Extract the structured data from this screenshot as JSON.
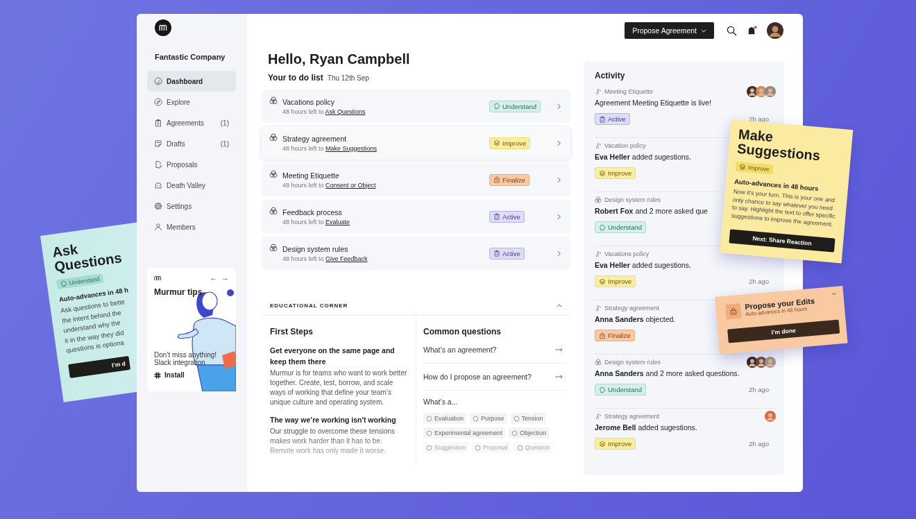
{
  "sidebar": {
    "company": "Fantastic Company",
    "items": [
      {
        "label": "Dashboard",
        "selected": true
      },
      {
        "label": "Explore",
        "selected": false
      },
      {
        "label": "Agreements",
        "count": "(1)",
        "selected": false
      },
      {
        "label": "Drafts",
        "count": "(1)",
        "selected": false
      },
      {
        "label": "Proposals",
        "selected": false
      },
      {
        "label": "Death Valley",
        "selected": false
      },
      {
        "label": "Settings",
        "selected": false
      },
      {
        "label": "Members",
        "selected": false
      }
    ]
  },
  "tips": {
    "title": "Murmur tips",
    "nav": [
      "←",
      "→"
    ],
    "message": "Don’t miss anything!",
    "detail": "Slack integration",
    "action": "Install"
  },
  "header": {
    "action": "Propose Agreement",
    "unread": true
  },
  "greeting": "Hello, Ryan Campbell",
  "todo": {
    "title": "Your to do list",
    "date": "Thu 12th Sep",
    "items": [
      {
        "title": "Vacations policy",
        "due": "48 hours left to",
        "task": "Ask Questions",
        "badge": {
          "kind": "understand",
          "label": "Understand"
        },
        "selected": false
      },
      {
        "title": "Strategy agreement",
        "due": "48 hours left to",
        "task": "Make Suggestions",
        "badge": {
          "kind": "improve",
          "label": "Improve"
        },
        "selected": true
      },
      {
        "title": "Meeting Etiquette",
        "due": "48 hours left to",
        "task": "Consent or Object",
        "badge": {
          "kind": "finalize",
          "label": "Finalize"
        },
        "selected": false
      },
      {
        "title": "Feedback process",
        "due": "48 hours left to",
        "task": "Evaluate",
        "badge": {
          "kind": "active",
          "label": "Active"
        },
        "selected": false
      },
      {
        "title": "Design system rules",
        "due": "48 hours left to",
        "task": "Give Feedback",
        "badge": {
          "kind": "active",
          "label": "Active"
        },
        "selected": false
      }
    ]
  },
  "education": {
    "title": "EDUCATIONAL CORNER",
    "expanded": true,
    "first_steps": {
      "title": "First Steps",
      "sections": [
        {
          "heading": "Get everyone on the same page and keep them there",
          "text": "Murmur is for teams who want to work better together. Create, test, borrow, and scale ways of working that define your team’s unique culture and operating system."
        },
        {
          "heading": "The way we’re working isn't working",
          "text": "Our struggle to overcome these tensions makes work harder than it has to be. Remote work has only made it worse."
        }
      ]
    },
    "questions": {
      "title": "Common questions",
      "items": [
        "What’s an agreement?",
        "How do I propose an agreement?"
      ],
      "terms_title": "What’s a...",
      "terms": [
        "Evaluation",
        "Purpose",
        "Tension",
        "Experimental agreement",
        "Objection",
        "Suggestion",
        "Proposal",
        "Question"
      ]
    }
  },
  "activity": {
    "title": "Activity",
    "items": [
      {
        "kind": "branch",
        "topic": "Meeting Etiquette",
        "text": "Agreement Meeting Etiquette is live!",
        "badge": {
          "kind": "active",
          "label": "Active"
        },
        "time": "2h ago",
        "avatars": [
          {
            "color": "#3b2f2a"
          },
          {
            "color": "#c98b5a"
          },
          {
            "color": "#8e8a86"
          }
        ]
      },
      {
        "kind": "branch",
        "topic": "Vacation policy",
        "actor": "Eva Heller",
        "text": "added sugestions.",
        "badge": {
          "kind": "improve",
          "label": "Improve"
        }
      },
      {
        "kind": "circles",
        "topic": "Design system rules",
        "actor": "Robert Fox",
        "text": "and 2 more asked que",
        "badge": {
          "kind": "understand",
          "label": "Understand"
        }
      },
      {
        "kind": "branch",
        "topic": "Vacations policy",
        "actor": "Eva Heller",
        "text": "added sugestions.",
        "badge": {
          "kind": "improve",
          "label": "Improve"
        },
        "time": "2h ago"
      },
      {
        "kind": "branch",
        "topic": "Strategy agreement",
        "actor": "Anna Sanders",
        "text": "objected.",
        "badge": {
          "kind": "finalize",
          "label": "Finalize"
        }
      },
      {
        "kind": "circles",
        "topic": "Design system rules",
        "actor": "Anna Sanders",
        "text": "and 2 more asked questions.",
        "badge": {
          "kind": "understand",
          "label": "Understand"
        },
        "time": "2h ago",
        "avatars": [
          {
            "color": "#2c2624"
          },
          {
            "color": "#6b4a3a"
          },
          {
            "color": "#9a9894"
          }
        ]
      },
      {
        "kind": "branch",
        "topic": "Strategy agreement",
        "actor": "Jerome Bell",
        "text": "added sugestions.",
        "badge": {
          "kind": "improve",
          "label": "Improve"
        },
        "time": "2h ago",
        "avatars": [
          {
            "color": "#d9694a"
          }
        ]
      }
    ]
  },
  "cards": [
    {
      "kind": "ask",
      "title": "Ask Questions",
      "badge": {
        "kind": "understand",
        "label": "Understand"
      },
      "subtitle": "Auto-advances in 48 h",
      "lines": [
        "Ask questions to bette",
        "the intent behind the",
        "understand why the",
        "it in the way they did",
        "questions is optiona"
      ],
      "button": "I’m d"
    },
    {
      "kind": "stage",
      "title": "Make Suggestions",
      "badge": {
        "kind": "improve",
        "label": "Improve"
      },
      "subtitle": "Auto-advances in 48 hours",
      "text": "Now it’s your turn. This is your one and only chance to say whatever you need to say. Highlight the text to offer specific suggestions to improve the agreement.",
      "button": "Next: Share Reaction"
    },
    {
      "kind": "compact",
      "title": "Propose your Edits",
      "badge": {
        "kind": "finalize"
      },
      "subtitle": "Auto-advances in 48 hours",
      "button": "I’m done",
      "collapsible": true
    }
  ]
}
